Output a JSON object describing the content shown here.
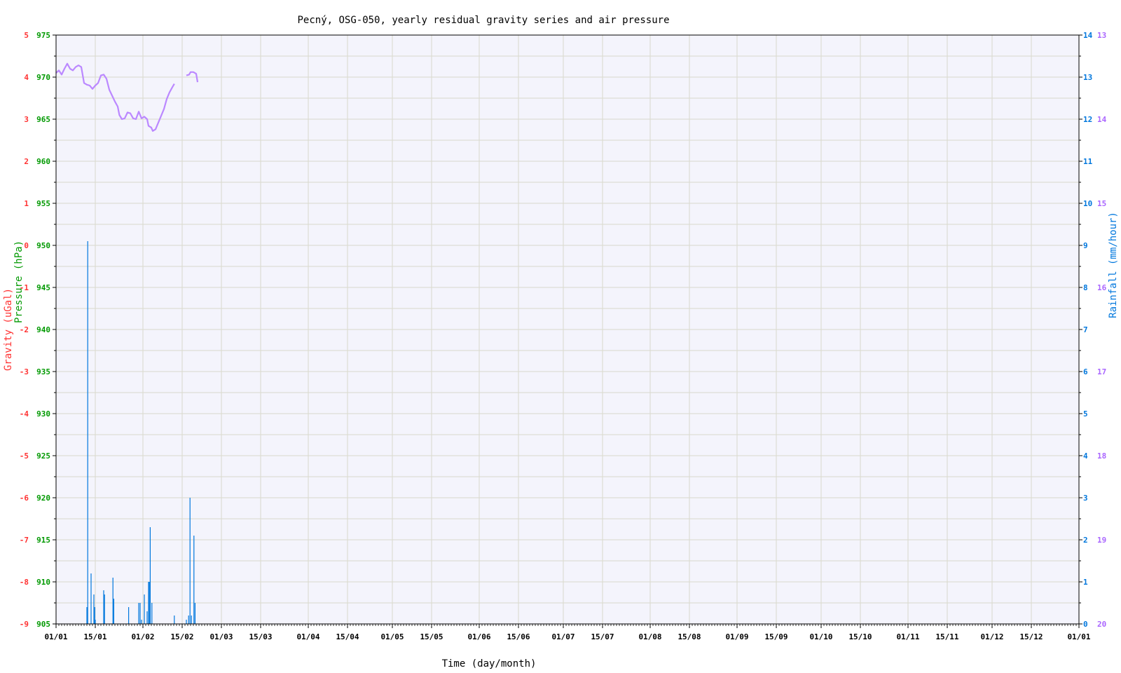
{
  "chart_data": {
    "type": "line",
    "title": "Pecný, OSG-050, yearly residual gravity series and air pressure",
    "xlabel": "Time (day/month)",
    "ylabel_gravity": "Gravity (uGal)",
    "ylabel_pressure": "Pressure (hPa)",
    "ylabel_rain": "Rainfall (mm/hour)",
    "x_range_days": [
      0,
      365
    ],
    "x_ticks": [
      "01/01",
      "15/01",
      "01/02",
      "15/02",
      "01/03",
      "15/03",
      "01/04",
      "15/04",
      "01/05",
      "15/05",
      "01/06",
      "15/06",
      "01/07",
      "15/07",
      "01/08",
      "15/08",
      "01/09",
      "15/09",
      "01/10",
      "15/10",
      "01/11",
      "15/11",
      "01/12",
      "15/12",
      "01/01"
    ],
    "gravity_axis": {
      "range": [
        -9,
        5
      ],
      "ticks": [
        "5",
        "4",
        "3",
        "2",
        "1",
        "0",
        "-1",
        "-2",
        "-3",
        "-4",
        "-5",
        "-6",
        "-7",
        "-8",
        "-9"
      ]
    },
    "pressure_axis": {
      "range": [
        905,
        975
      ],
      "ticks": [
        "975",
        "970",
        "965",
        "960",
        "955",
        "950",
        "945",
        "940",
        "935",
        "930",
        "925",
        "920",
        "915",
        "910",
        "905"
      ]
    },
    "rain_axis": {
      "range": [
        0,
        14
      ],
      "ticks": [
        "14",
        "13",
        "12",
        "11",
        "10",
        "9",
        "8",
        "7",
        "6",
        "5",
        "4",
        "3",
        "2",
        "1",
        "0"
      ]
    },
    "extra_axis": {
      "ticks": [
        "13",
        "14",
        "15",
        "16",
        "17",
        "18",
        "19",
        "20"
      ]
    },
    "grid": true,
    "colors": {
      "gravity": "#ff3333",
      "pressure": "#009900",
      "pressure_series": "#bb88ff",
      "rain": "#0077dd",
      "extra": "#aa66ff",
      "plot_bg": "#f4f4fc",
      "grid": "#d9d9cc"
    },
    "series": [
      {
        "name": "Pressure (hPa)",
        "color": "#bb88ff",
        "points": [
          [
            0,
            970.5
          ],
          [
            1,
            970.8
          ],
          [
            2,
            970.3
          ],
          [
            3,
            971
          ],
          [
            4,
            971.6
          ],
          [
            5,
            971
          ],
          [
            6,
            970.8
          ],
          [
            7,
            971.2
          ],
          [
            8,
            971.4
          ],
          [
            9,
            971.2
          ],
          [
            10,
            969.3
          ],
          [
            11,
            969.1
          ],
          [
            12,
            969
          ],
          [
            13,
            968.6
          ],
          [
            14,
            969
          ],
          [
            15,
            969.3
          ],
          [
            16,
            970.2
          ],
          [
            17,
            970.3
          ],
          [
            18,
            969.8
          ],
          [
            19,
            968.5
          ],
          [
            20,
            967.8
          ],
          [
            21,
            967.1
          ],
          [
            22,
            966.5
          ],
          [
            22.6,
            965.5
          ],
          [
            23.5,
            965
          ],
          [
            24.5,
            965.1
          ],
          [
            25.5,
            965.8
          ],
          [
            26.5,
            965.7
          ],
          [
            27.5,
            965.1
          ],
          [
            28.5,
            965
          ],
          [
            29.5,
            965.9
          ],
          [
            30.5,
            965.1
          ],
          [
            31.5,
            965.3
          ],
          [
            32.5,
            965
          ],
          [
            33,
            964.2
          ],
          [
            34,
            964
          ],
          [
            34.5,
            963.6
          ],
          [
            35.5,
            963.8
          ],
          [
            36.5,
            964.6
          ],
          [
            37.5,
            965.4
          ],
          [
            38.5,
            966.2
          ],
          [
            39.5,
            967.4
          ],
          [
            40.5,
            968.2
          ],
          [
            41.5,
            968.8
          ],
          [
            42.2,
            969.2
          ],
          [
            46.5,
            970.2
          ],
          [
            47.5,
            970.3
          ],
          [
            48,
            970.6
          ],
          [
            49,
            970.6
          ],
          [
            50,
            970.4
          ],
          [
            50.5,
            969.4
          ]
        ]
      },
      {
        "name": "Rainfall (mm/hour)",
        "color": "#0077dd",
        "bars": [
          [
            11,
            0.4
          ],
          [
            11.3,
            9.1
          ],
          [
            12.5,
            1.2
          ],
          [
            13.5,
            0.7
          ],
          [
            13.8,
            0.4
          ],
          [
            14,
            0.1
          ],
          [
            17,
            0.8
          ],
          [
            17.3,
            0.7
          ],
          [
            20.3,
            1.1
          ],
          [
            20.6,
            0.6
          ],
          [
            25.9,
            0.4
          ],
          [
            29.5,
            0.5
          ],
          [
            30,
            0.5
          ],
          [
            30.5,
            0.1
          ],
          [
            31.5,
            0.7
          ],
          [
            32.5,
            0.3
          ],
          [
            33,
            1
          ],
          [
            33.3,
            1
          ],
          [
            33.6,
            2.3
          ],
          [
            34.2,
            0.5
          ],
          [
            42.2,
            0.2
          ],
          [
            46.5,
            0.1
          ],
          [
            47.3,
            0.2
          ],
          [
            47.8,
            3
          ],
          [
            48.3,
            0.2
          ],
          [
            49.2,
            2.1
          ],
          [
            49.6,
            0.5
          ]
        ]
      }
    ]
  }
}
